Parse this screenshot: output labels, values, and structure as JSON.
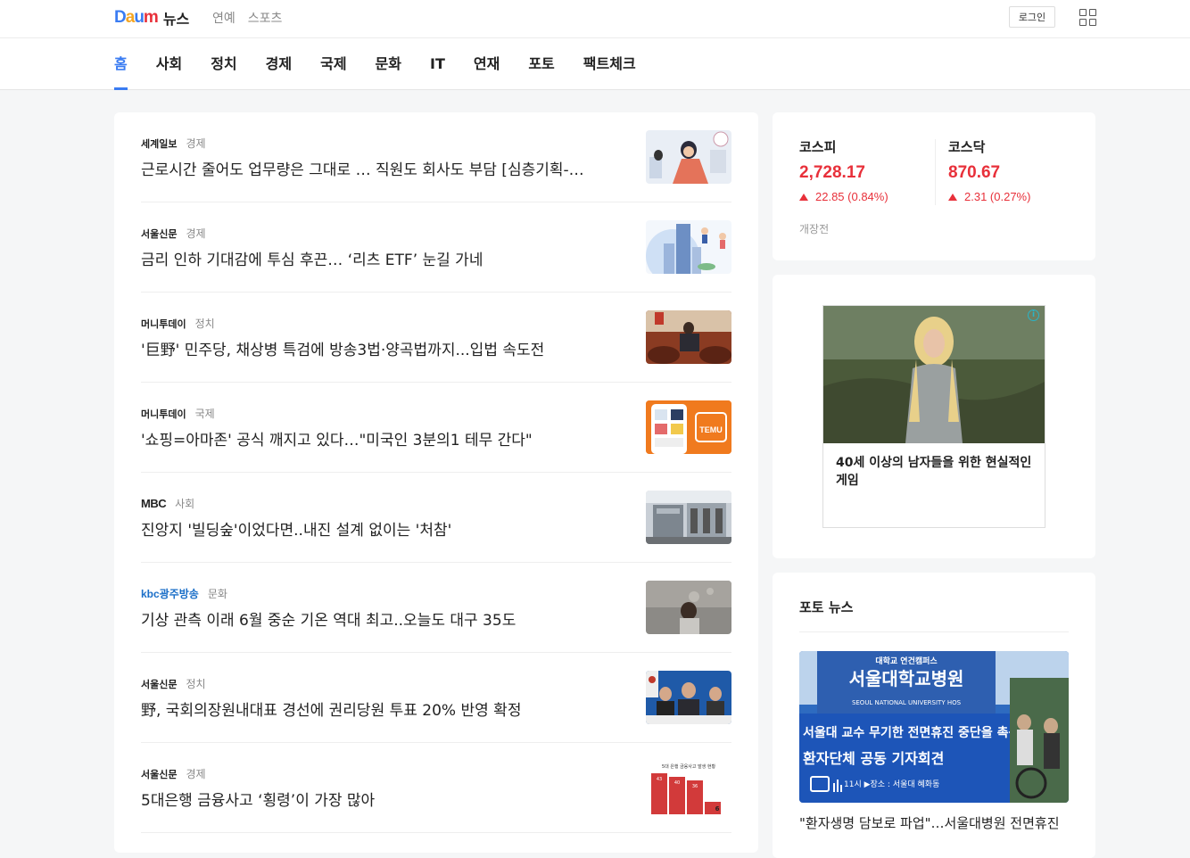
{
  "header": {
    "logo_mark": "Daum",
    "logo_text": "뉴스",
    "links": [
      "연예",
      "스포츠"
    ],
    "login_label": "로그인",
    "apps_icon": "grid-icon"
  },
  "nav": {
    "items": [
      "홈",
      "사회",
      "정치",
      "경제",
      "국제",
      "문화",
      "IT",
      "연재",
      "포토",
      "팩트체크"
    ],
    "active_index": 0,
    "accent_color": "#3a7cf2"
  },
  "articles": [
    {
      "press": "세계일보",
      "category": "경제",
      "title": "근로시간 줄어도 업무량은 그대로 … 직원도 회사도 부담 [심층기획-…"
    },
    {
      "press": "서울신문",
      "category": "경제",
      "title": "금리 인하 기대감에 투심 후끈… ‘리츠 ETF’ 눈길 가네"
    },
    {
      "press": "머니투데이",
      "category": "정치",
      "title": "'巨野' 민주당, 채상병 특검에 방송3법·양곡법까지...입법 속도전"
    },
    {
      "press": "머니투데이",
      "category": "국제",
      "title": "'쇼핑=아마존' 공식 깨지고 있다…\"미국인 3분의1 테무 간다\""
    },
    {
      "press": "MBC",
      "category": "사회",
      "title": "진앙지 '빌딩숲'이었다면..내진 설계 없이는 '처참'"
    },
    {
      "press": "kbc광주방송",
      "category": "문화",
      "title": "기상 관측 이래 6월 중순 기온 역대 최고..오늘도 대구 35도"
    },
    {
      "press": "서울신문",
      "category": "정치",
      "title": "野, 국회의장원내대표 경선에 권리당원 투표 20% 반영 확정"
    },
    {
      "press": "서울신문",
      "category": "경제",
      "title": "5대은행 금융사고 ‘횡령’이 가장 많아"
    }
  ],
  "market": {
    "kospi": {
      "name": "코스피",
      "value": "2,728.17",
      "change": "22.85 (0.84%)"
    },
    "kosdaq": {
      "name": "코스닥",
      "value": "870.67",
      "change": "2.31 (0.27%)"
    },
    "status": "개장전",
    "up_color": "#e8303a"
  },
  "ad": {
    "text": "40세 이상의 남자들을 위한 현실적인 게임",
    "info_icon": "i"
  },
  "photo_news": {
    "title": "포토 뉴스",
    "caption": "\"환자생명 담보로 파업\"…서울대병원 전면휴진",
    "image_texts": {
      "sign_top": "대학교 연건캠퍼스",
      "sign_main": "서울대학교병원",
      "sign_en": "SEOUL NATIONAL UNIVERSITY HOS",
      "banner1": "서울대 교수 무기한 전면휴진 중단을 촉구하는",
      "banner2": "환자단체 공동 기자회견",
      "banner3": "11시 ▶장소 : 서울대 혜화동"
    },
    "thumb_texts": {
      "temu": "TEMU",
      "bank_title": "5대 은행 금융사고 발생 현황",
      "bank_vals": [
        "43",
        "40",
        "36",
        "6"
      ]
    }
  }
}
